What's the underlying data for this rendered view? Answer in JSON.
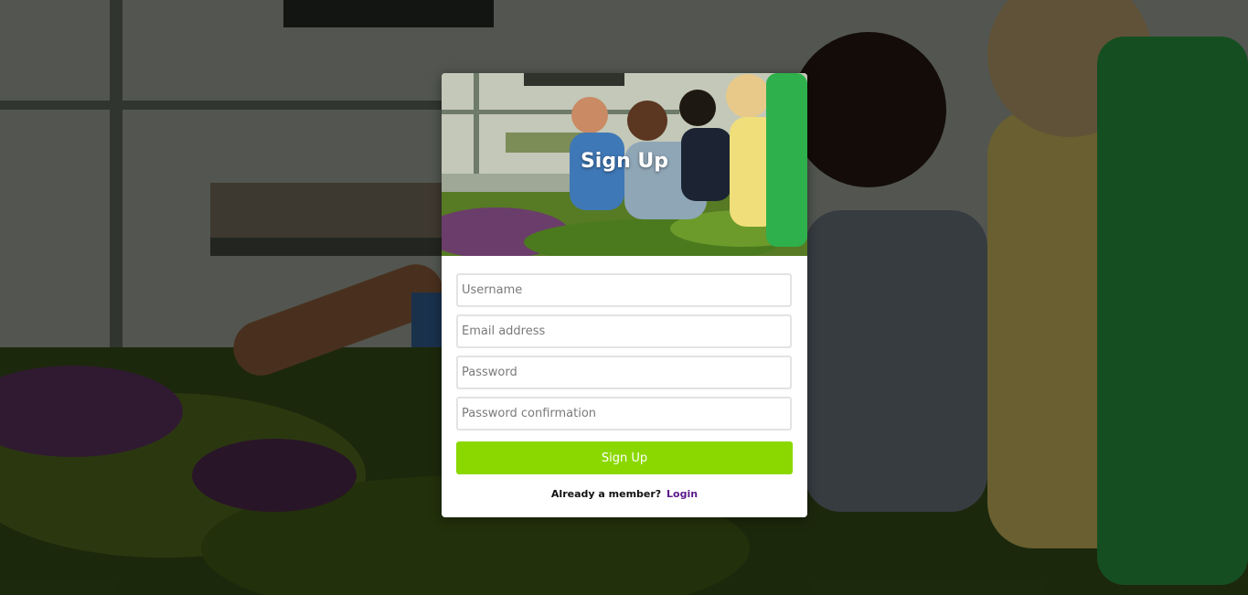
{
  "page": {
    "title": "Sign Up"
  },
  "form": {
    "username_placeholder": "Username",
    "email_placeholder": "Email address",
    "password_placeholder": "Password",
    "password_confirmation_placeholder": "Password confirmation",
    "submit_label": "Sign Up"
  },
  "footer": {
    "prompt": "Already a member?",
    "login_link": "Login"
  },
  "colors": {
    "accent": "#8bd800",
    "link": "#5a1a8c"
  },
  "background": {
    "description_icon": "children-gardening-photo"
  }
}
